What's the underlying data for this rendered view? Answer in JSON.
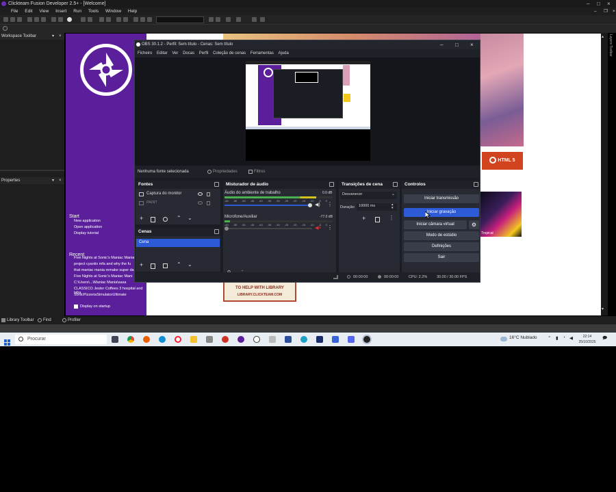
{
  "clickteam": {
    "title": "Clickteam Fusion Developer 2.5+ - [Welcome]",
    "menu": [
      "File",
      "Edit",
      "View",
      "Insert",
      "Run",
      "Tools",
      "Window",
      "Help"
    ],
    "workspace_toolbar": "Workspace Toolbar",
    "properties": "Properties",
    "layers_toolbar": "Layers Toolbar",
    "start_heading": "Start",
    "start_links": [
      "New application",
      "Open application",
      "Display tutorial"
    ],
    "recent_heading": "Recent",
    "recent_items": [
      "Five Nights at Sonic's Maniac Mania",
      "project cyantix mfa and why the fu",
      "that maniac mania remake super da",
      "Five Nights at Sonic's Maniac Mani",
      "C:\\Users\\...\\Maniac Mania\\sasa",
      "CLASSICO Jester Coffees 3 hospital and laba",
      "SonicPizzeriaSimulatorUltimate"
    ],
    "display_on_startup": "Display on startup",
    "html5_label": "HTML 5",
    "tropical_label": "Tropical",
    "library_banner_line1": "TO HELP WITH LIBRARY",
    "library_banner_line2": "LIBRARY.CLICKTEAM.COM",
    "bottom_tabs": {
      "library": "Library Toolbar",
      "find": "Find",
      "profiler": "Profiler"
    }
  },
  "obs": {
    "title": "OBS 30.1.2 - Perfil: Sem título - Cenas: Sem título",
    "menu": [
      "Ficheiro",
      "Editar",
      "Ver",
      "Docas",
      "Perfil",
      "Coleção de cenas",
      "Ferramentas",
      "Ajuda"
    ],
    "no_source_selected": "Nenhuma fonte selecionada",
    "properties_button": "Propriedades",
    "filters_button": "Filtros",
    "sources": {
      "title": "Fontes",
      "items": [
        {
          "name": "Captura do monitor"
        },
        {
          "name": "PAINT"
        }
      ]
    },
    "scenes": {
      "title": "Cenas",
      "items": [
        {
          "name": "Cena"
        }
      ]
    },
    "audio_mixer": {
      "title": "Misturador de áudio",
      "tracks": [
        {
          "name": "Áudio do ambiente de trabalho",
          "db": "0.0 dB",
          "level": 0.85,
          "scale": [
            "-60",
            "-55",
            "-50",
            "-45",
            "-40",
            "-35",
            "-30",
            "-25",
            "-20",
            "-15",
            "-10",
            "-5",
            "0"
          ]
        },
        {
          "name": "Microfone/Auxiliar",
          "db": "-77.0 dB",
          "level": 0.05,
          "scale": [
            "-60",
            "-55",
            "-50",
            "-45",
            "-40",
            "-35",
            "-30",
            "-25",
            "-20",
            "-15",
            "-10",
            "-5",
            "0"
          ]
        }
      ]
    },
    "transitions": {
      "title": "Transições de cena",
      "selected": "Desvanecer",
      "duration_label": "Duração",
      "duration_value": "10000 ms"
    },
    "controls": {
      "title": "Controlos",
      "buttons": [
        "Iniciar transmissão",
        "Iniciar gravação",
        "Iniciar câmara virtual",
        "Modo de estúdio",
        "Definições",
        "Sair"
      ]
    },
    "status": {
      "stream_time": "00:00:00",
      "rec_time": "00:00:00",
      "cpu": "CPU: 2.2%",
      "fps": "30.00 / 30.00 FPS"
    }
  },
  "taskbar": {
    "search_placeholder": "Procurar",
    "weather": "16°C  Nublado",
    "time": "22:14",
    "date": "25/10/2025"
  },
  "colors": {
    "clickteam_purple": "#5c1f9b",
    "obs_accent_blue": "#2d5bd7",
    "meter_green": "#4caf50",
    "meter_yellow": "#d4c21e",
    "meter_red": "#d33"
  }
}
